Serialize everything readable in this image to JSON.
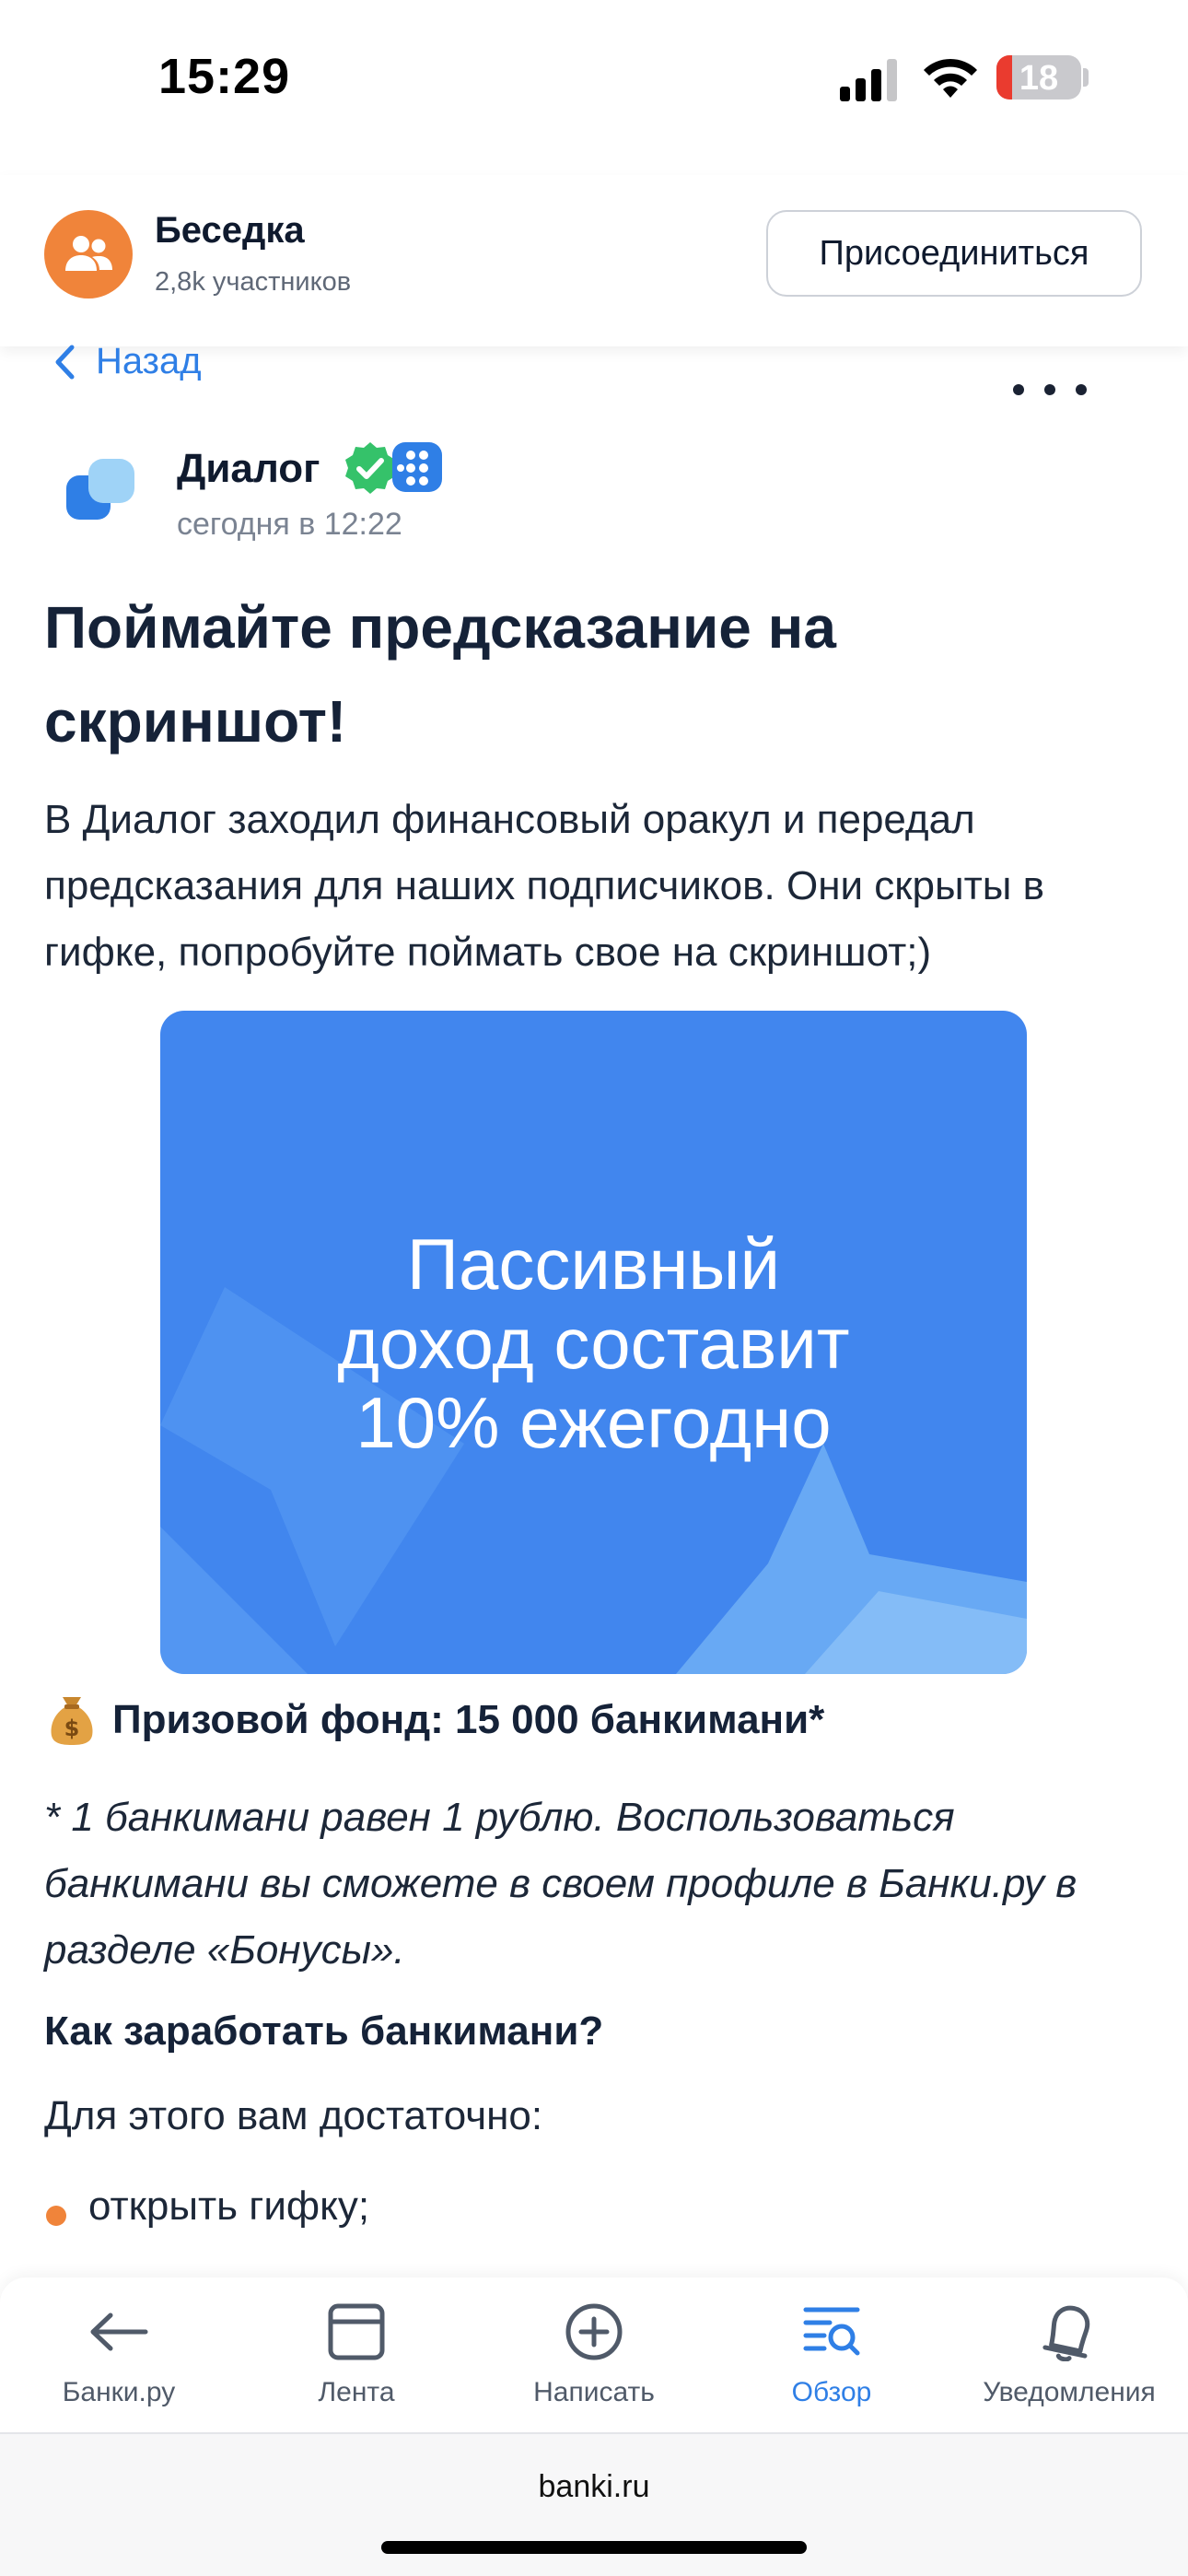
{
  "status_bar": {
    "time": "15:29",
    "battery": "18"
  },
  "community": {
    "name": "Беседка",
    "members": "2,8k участников",
    "join_label": "Присоединиться"
  },
  "nav": {
    "back_label": "Назад"
  },
  "post": {
    "author": "Диалог",
    "time": "сегодня в 12:22",
    "title": "Поймайте предсказание на скриншот!",
    "text": "В Диалог заходил финансовый оракул и передал предсказания для наших подписчиков. Они скрыты в гифке, попробуйте поймать свое на скриншот;)",
    "gif_text": [
      "Пассивный",
      "доход составит",
      "10% ежегодно"
    ],
    "prize": "Призовой фонд: 15 000 банкимани*",
    "note": "* 1 банкимани равен 1 рублю. Воспользоваться банкимани вы сможете в своем профиле в Банки.ру в разделе «Бонусы».",
    "howto": "Как заработать банкимани?",
    "enough": "Для этого вам достаточно:",
    "bullets": [
      "открыть гифку;"
    ]
  },
  "tabbar": {
    "items": [
      {
        "label": "Банки.ру",
        "icon": "arrow-left-icon"
      },
      {
        "label": "Лента",
        "icon": "feed-icon"
      },
      {
        "label": "Написать",
        "icon": "plus-circle-icon"
      },
      {
        "label": "Обзор",
        "icon": "overview-search-icon",
        "active": true
      },
      {
        "label": "Уведомления",
        "icon": "bell-icon"
      }
    ]
  },
  "browser": {
    "url": "banki.ru"
  },
  "colors": {
    "accent": "#2f7fe6",
    "orange": "#f0843a",
    "gif_bg": "#4186ee",
    "verified": "#35c26a"
  }
}
